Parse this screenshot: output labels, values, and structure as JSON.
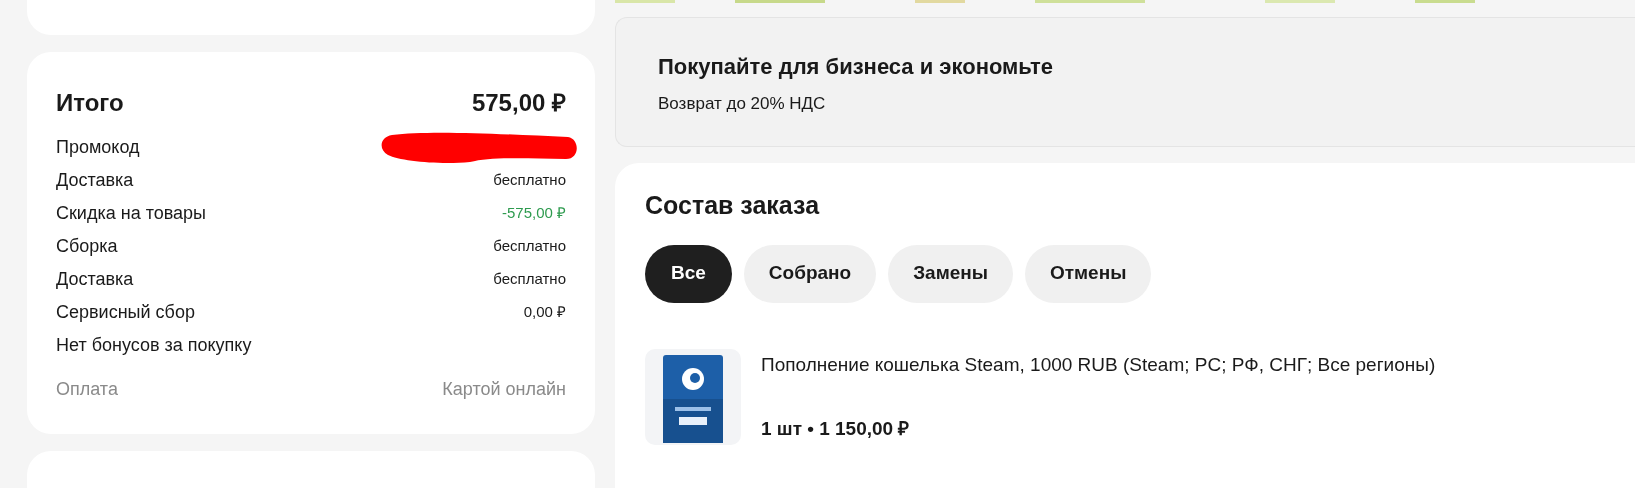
{
  "summary": {
    "title": "Итого",
    "total": "575,00 ₽",
    "rows": [
      {
        "kind": "redacted",
        "label": "Промокод"
      },
      {
        "kind": "plain",
        "label": "Доставка",
        "value": "бесплатно"
      },
      {
        "kind": "discount",
        "label": "Скидка на товары",
        "value": "-575,00 ₽"
      },
      {
        "kind": "plain",
        "label": "Сборка",
        "value": "бесплатно"
      },
      {
        "kind": "plain",
        "label": "Доставка",
        "value": "бесплатно"
      },
      {
        "kind": "plain",
        "label": "Сервисный сбор",
        "value": "0,00 ₽"
      },
      {
        "kind": "note",
        "label": "Нет бонусов за покупку"
      },
      {
        "kind": "payment",
        "label": "Оплата",
        "value": "Картой онлайн"
      }
    ]
  },
  "business_banner": {
    "title": "Покупайте для бизнеса и экономьте",
    "subtitle": "Возврат до 20% НДС"
  },
  "order": {
    "title": "Состав заказа",
    "filters": [
      {
        "label": "Все",
        "selected": true
      },
      {
        "label": "Собрано",
        "selected": false
      },
      {
        "label": "Замены",
        "selected": false
      },
      {
        "label": "Отмены",
        "selected": false
      }
    ],
    "items": [
      {
        "name": "Пополнение кошелька Steam, 1000 RUB (Steam; PC; РФ, СНГ; Все регионы)",
        "quantity_price": "1 шт • 1 150,00 ₽"
      }
    ]
  }
}
